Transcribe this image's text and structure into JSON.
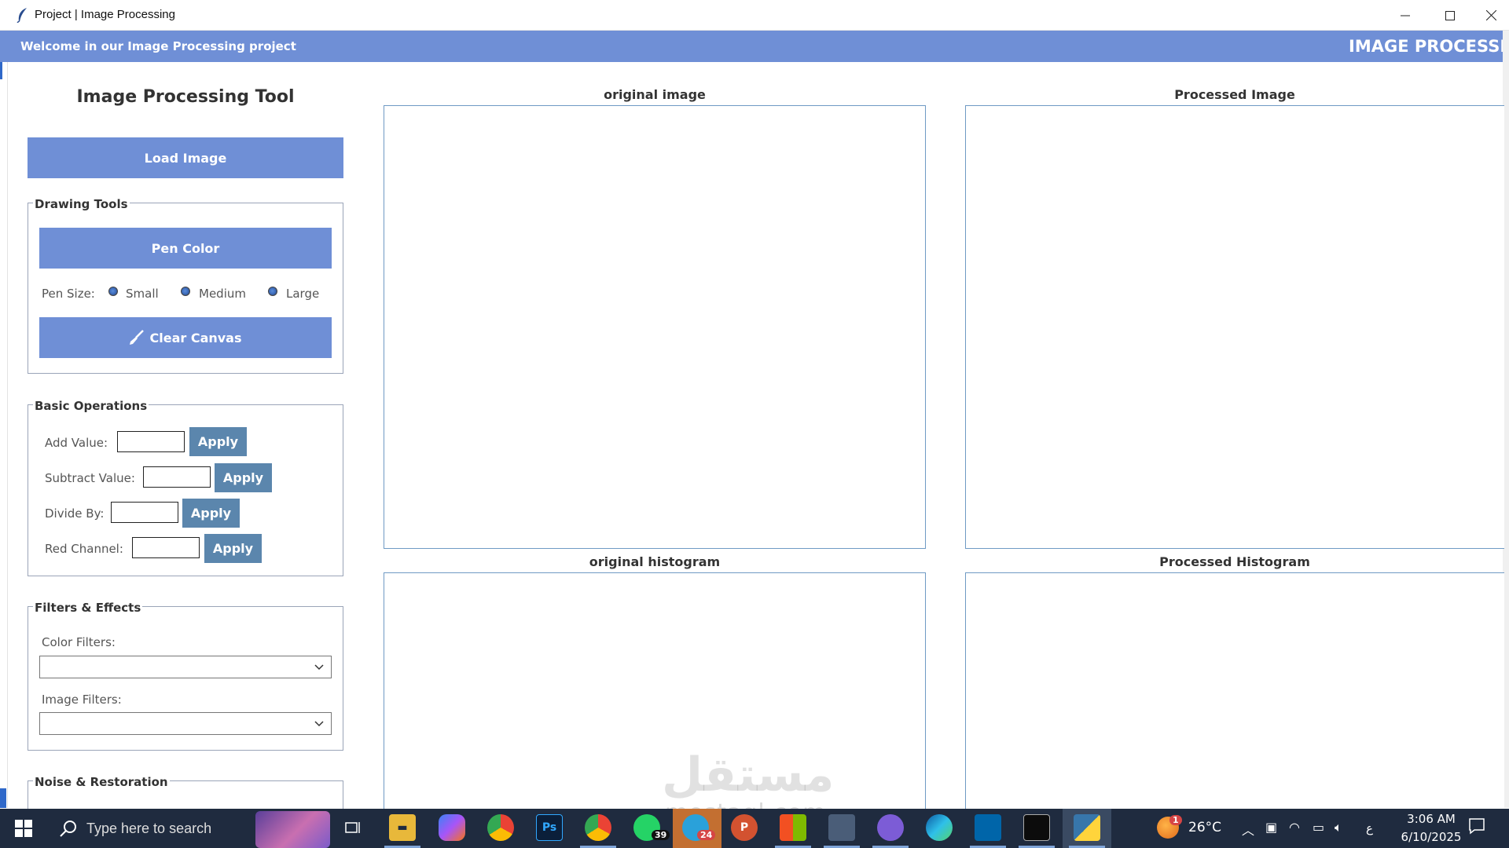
{
  "window": {
    "title": "Project | Image Processing"
  },
  "banner": {
    "welcome": "Welcome in our Image Processing project",
    "marquee": "IMAGE PROCESSI"
  },
  "sidebar": {
    "tool_title": "Image Processing Tool",
    "load_button": "Load Image",
    "drawing": {
      "legend": "Drawing Tools",
      "pen_color": "Pen Color",
      "pen_size_label": "Pen Size:",
      "sizes": [
        "Small",
        "Medium",
        "Large"
      ],
      "clear_canvas": "Clear Canvas"
    },
    "basic": {
      "legend": "Basic Operations",
      "rows": [
        {
          "label": "Add Value:",
          "apply": "Apply",
          "value": ""
        },
        {
          "label": "Subtract Value:",
          "apply": "Apply",
          "value": ""
        },
        {
          "label": "Divide By:",
          "apply": "Apply",
          "value": ""
        },
        {
          "label": "Red Channel:",
          "apply": "Apply",
          "value": ""
        }
      ]
    },
    "filters": {
      "legend": "Filters & Effects",
      "color_label": "Color Filters:",
      "color_value": "",
      "image_label": "Image Filters:",
      "image_value": ""
    },
    "noise": {
      "legend": "Noise & Restoration"
    }
  },
  "panels": {
    "original_image": "original image",
    "processed_image": "Processed Image",
    "original_histogram": "original histogram",
    "processed_histogram": "Processed Histogram"
  },
  "watermark": {
    "arabic": "مستقل",
    "latin": "mostaql.com"
  },
  "taskbar": {
    "search_placeholder": "Type here to search",
    "whatsapp_badge": "39",
    "telegram_badge": "24",
    "weather_badge": "1",
    "temperature": "26°C",
    "lang": "ع",
    "time": "3:06 AM",
    "date": "6/10/2025"
  },
  "colors": {
    "accent": "#6f8fd6",
    "apply": "#5b86ad",
    "panel_border": "#6f9ac4",
    "taskbar": "#1f2b3f"
  }
}
